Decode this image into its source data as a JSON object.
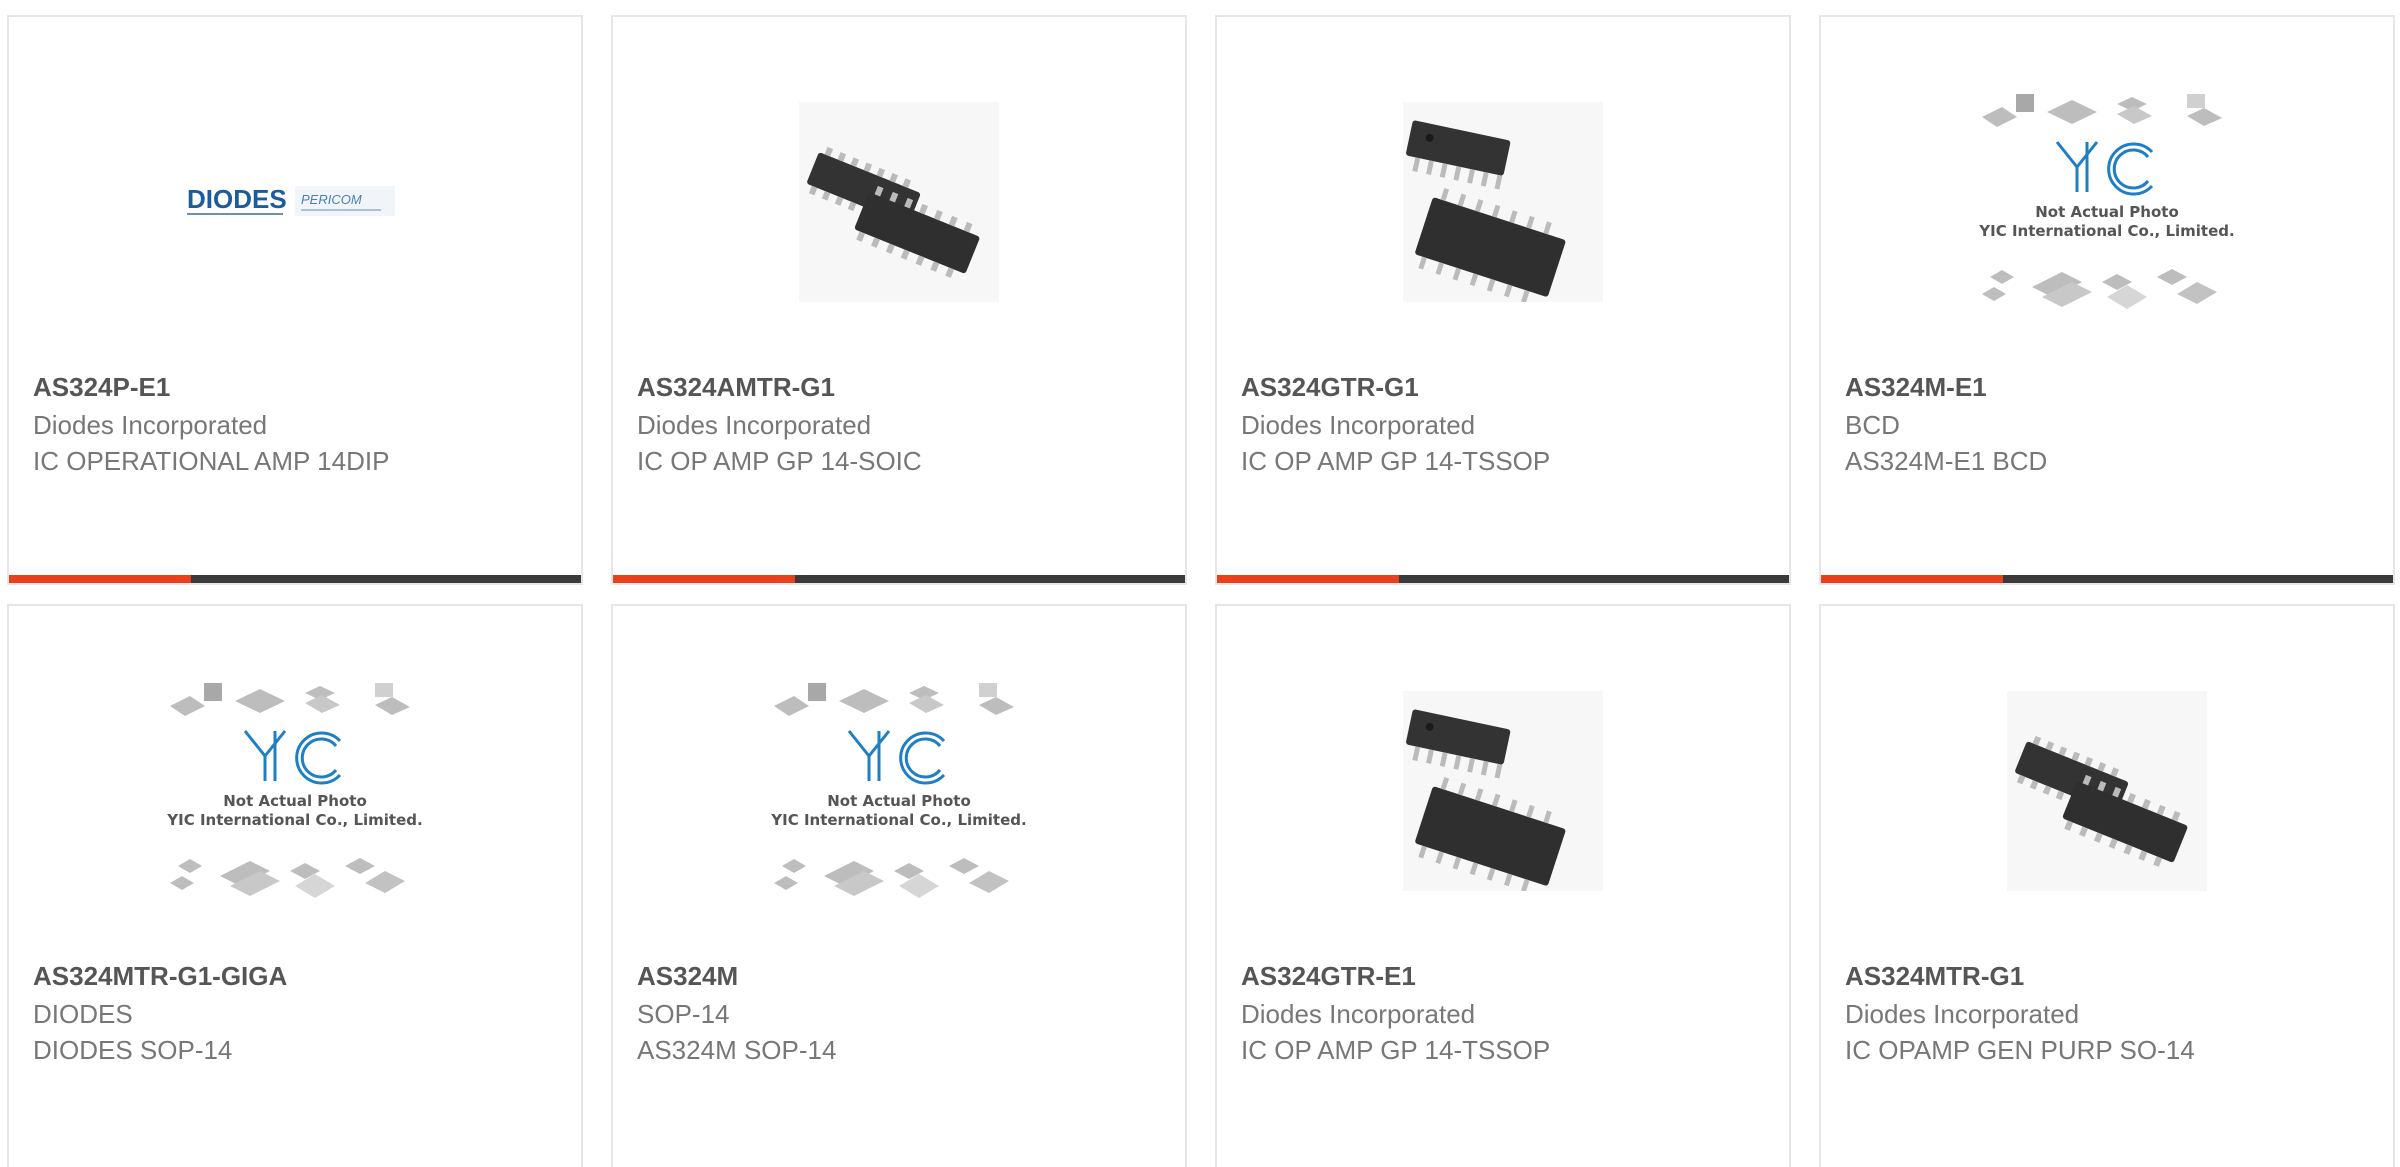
{
  "accent_color": "#e8401c",
  "bar_color": "#3a3a3a",
  "products": [
    {
      "part": "AS324P-E1",
      "manufacturer": "Diodes Incorporated",
      "description": "IC OPERATIONAL AMP 14DIP",
      "image": "diodes-pericom-logo",
      "logo_text_1": "DIODES",
      "logo_text_2": "PERICOM"
    },
    {
      "part": "AS324AMTR-G1",
      "manufacturer": "Diodes Incorporated",
      "description": "IC OP AMP GP 14-SOIC",
      "image": "soic-14-chip-photo"
    },
    {
      "part": "AS324GTR-G1",
      "manufacturer": "Diodes Incorporated",
      "description": "IC OP AMP GP 14-TSSOP",
      "image": "tssop-14-chip-photo"
    },
    {
      "part": "AS324M-E1",
      "manufacturer": "BCD",
      "description": "AS324M-E1 BCD",
      "image": "yic-placeholder",
      "placeholder_line_1": "Not Actual Photo",
      "placeholder_line_2": "YIC International Co., Limited."
    },
    {
      "part": "AS324MTR-G1-GIGA",
      "manufacturer": "DIODES",
      "description": "DIODES SOP-14",
      "image": "yic-placeholder",
      "placeholder_line_1": "Not Actual Photo",
      "placeholder_line_2": "YIC International Co., Limited."
    },
    {
      "part": "AS324M",
      "manufacturer": "SOP-14",
      "description": "AS324M SOP-14",
      "image": "yic-placeholder",
      "placeholder_line_1": "Not Actual Photo",
      "placeholder_line_2": "YIC International Co., Limited."
    },
    {
      "part": "AS324GTR-E1",
      "manufacturer": "Diodes Incorporated",
      "description": "IC OP AMP GP 14-TSSOP",
      "image": "tssop-14-chip-photo"
    },
    {
      "part": "AS324MTR-G1",
      "manufacturer": "Diodes Incorporated",
      "description": "IC OPAMP GEN PURP SO-14",
      "image": "soic-14-chip-photo"
    }
  ]
}
